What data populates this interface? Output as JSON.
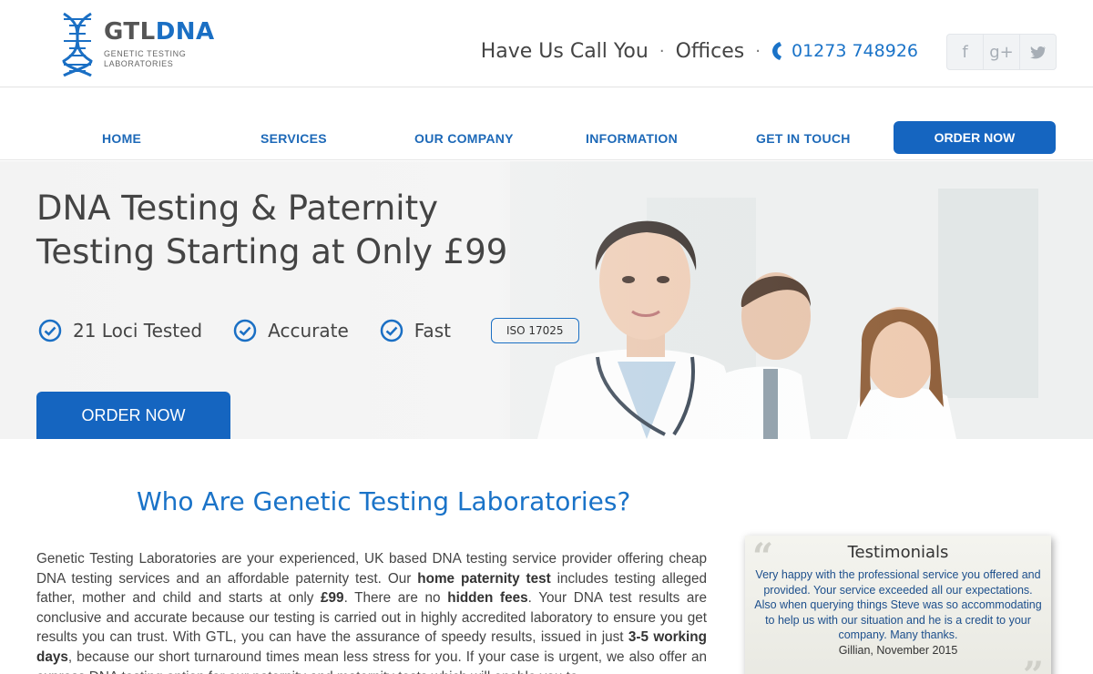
{
  "logo": {
    "brand_a": "GTL",
    "brand_b": "DNA",
    "sub_line1": "Genetic Testing",
    "sub_line2": "Laboratories"
  },
  "header": {
    "call_label": "Have Us Call You",
    "separator": "·",
    "offices_label": "Offices",
    "phone": "01273 748926",
    "social": {
      "facebook": "f",
      "googleplus": "g+",
      "twitter": "t"
    }
  },
  "nav": {
    "items": [
      {
        "label": "HOME"
      },
      {
        "label": "SERVICES"
      },
      {
        "label": "OUR COMPANY"
      },
      {
        "label": "INFORMATION"
      },
      {
        "label": "GET IN TOUCH"
      }
    ],
    "order_label": "ORDER NOW"
  },
  "hero": {
    "title_line1": "DNA Testing & Paternity",
    "title_line2": "Testing Starting at Only £99",
    "features": [
      "21 Loci Tested",
      "Accurate",
      "Fast"
    ],
    "iso": "ISO 17025",
    "order_label": "ORDER NOW"
  },
  "about": {
    "heading": "Who Are Genetic Testing Laboratories?",
    "p1": "Genetic Testing Laboratories are your experienced, UK based DNA testing service provider offering cheap DNA testing services and an affordable paternity test. Our ",
    "b1": "home paternity test",
    "p2": " includes testing alleged father, mother and child and starts at only ",
    "b2": "£99",
    "p3": ". There are no ",
    "b3": "hidden fees",
    "p4": ". Your DNA test results are conclusive and accurate because our testing is carried out in highly accredited laboratory to ensure you get results you can trust. With GTL, you can have the assurance of speedy results, issued in just ",
    "b4": "3-5 working days",
    "p5": ", because our short turnaround times mean less stress for you. If your case is urgent, we also offer an express DNA testing option for our paternity and maternity tests which will enable you to"
  },
  "testimonial": {
    "title": "Testimonials",
    "text": "Very happy with the professional service you offered and provided. Your service exceeded all our expectations. Also when querying things Steve was so accommodating to help us with our situation and he is a credit to your company. Many thanks.",
    "author": "Gillian, November 2015"
  },
  "colors": {
    "brand_blue": "#1565c0",
    "link_blue": "#1a73c8"
  }
}
